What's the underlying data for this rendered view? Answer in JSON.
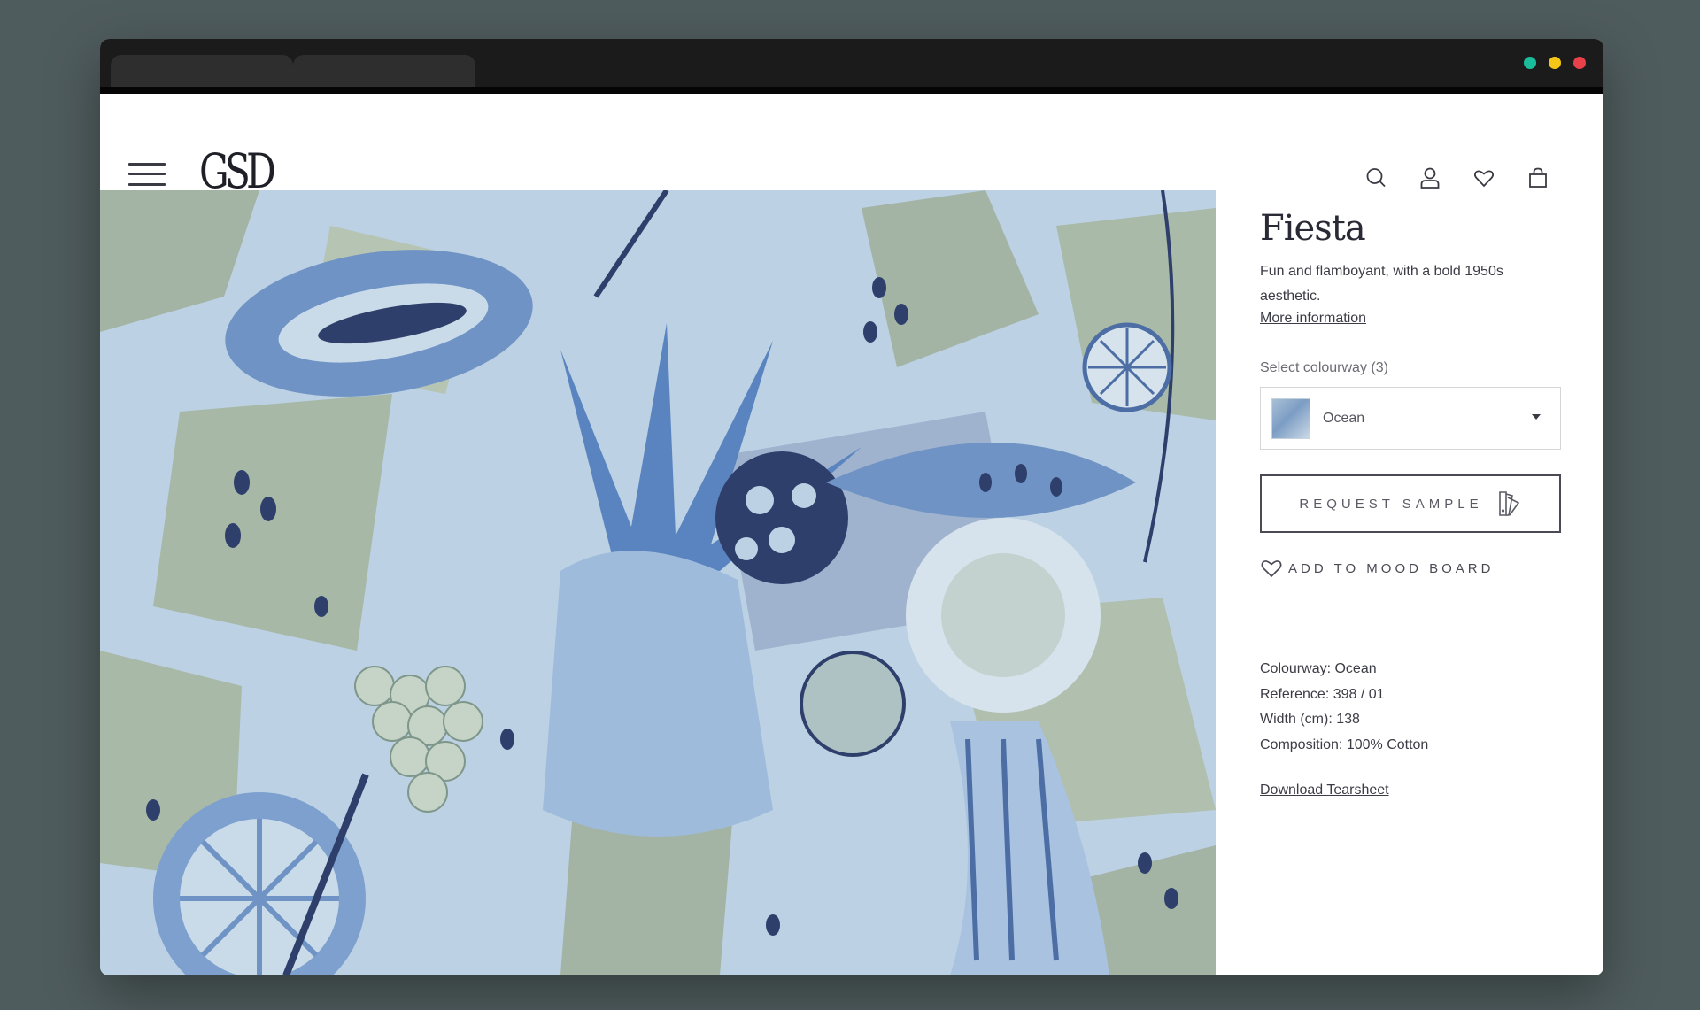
{
  "window": {
    "traffic_lights": [
      {
        "name": "green",
        "color": "#1bbc9b"
      },
      {
        "name": "yellow",
        "color": "#f5c518"
      },
      {
        "name": "red",
        "color": "#e8414a"
      }
    ]
  },
  "header": {
    "logo": "GSD",
    "menu_icon": "hamburger-menu-icon",
    "icons": [
      "search-icon",
      "account-icon",
      "wishlist-heart-icon",
      "shopping-bag-icon"
    ]
  },
  "product": {
    "title": "Fiesta",
    "description": "Fun and flamboyant, with a bold 1950s aesthetic.",
    "more_info_link": "More information",
    "colourway_select": {
      "label": "Select colourway (3)",
      "selected": "Ocean"
    },
    "request_sample_label": "REQUEST SAMPLE",
    "add_to_moodboard_label": "ADD TO MOOD BOARD",
    "details": [
      "Colourway: Ocean",
      "Reference:  398 / 01",
      "Width (cm): 138",
      "Composition: 100% Cotton"
    ],
    "download_tearsheet": "Download Tearsheet"
  },
  "colors": {
    "background": "#4f5c5d",
    "pattern_light_blue": "#bcd1e4",
    "pattern_mid_blue": "#6f93c5",
    "pattern_navy": "#2f3f6b",
    "pattern_sage": "#a3b4a4"
  }
}
